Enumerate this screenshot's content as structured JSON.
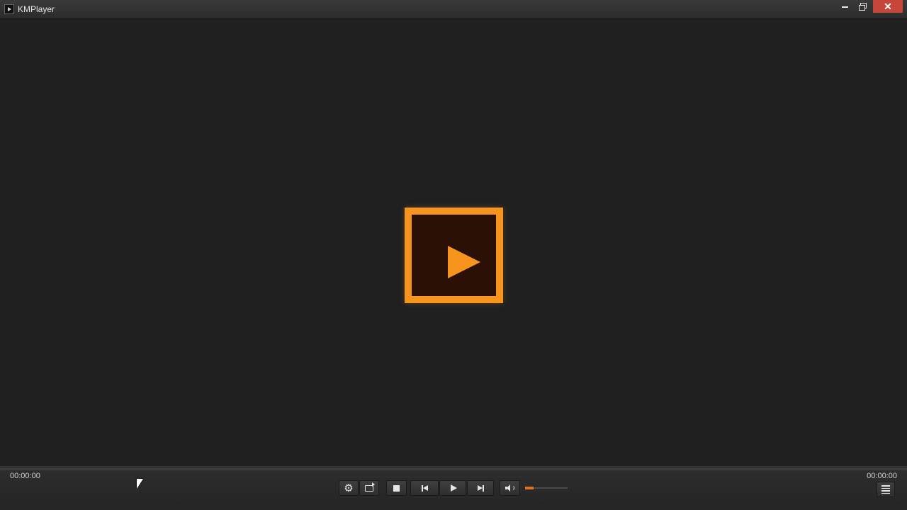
{
  "window": {
    "title": "KMPlayer",
    "close_symbol": "✕"
  },
  "icons": {
    "app": "kmplayer-app-icon",
    "minimize": "minimize-icon",
    "maximize": "restore-icon",
    "close": "close-icon",
    "logo": "play-logo-icon",
    "settings": "gear-icon",
    "repeat": "repeat-icon",
    "stop": "stop-icon",
    "previous": "skip-previous-icon",
    "play": "play-icon",
    "next": "skip-next-icon",
    "volume": "volume-icon",
    "playlist": "playlist-icon"
  },
  "colors": {
    "accent": "#f7941e",
    "close_button": "#c7463a",
    "volume_fill": "#e0711f"
  },
  "controls": {
    "settings_symbol": "⚙",
    "elapsed_time": "00:00:00",
    "total_time": "00:00:00",
    "progress_fraction": 0,
    "volume_fraction": 0.2
  }
}
